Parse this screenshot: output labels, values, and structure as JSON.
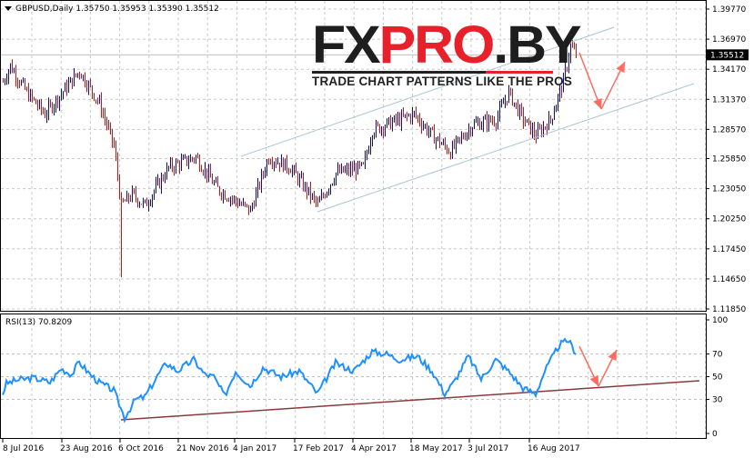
{
  "header": {
    "symbol": "GBPUSD,Daily",
    "open": "1.35750",
    "high": "1.35953",
    "low": "1.35390",
    "close": "1.35512",
    "dropdown_icon": "triangle-down-icon"
  },
  "logo": {
    "part1": "FX",
    "part2": "PRO",
    "part3": ".BY",
    "tagline": "TRADE CHART PATTERNS LIKE THE PROS"
  },
  "colors": {
    "up": "#0000ff",
    "down": "#ff0000",
    "rsi": "#1e90ff",
    "channel": "#a8c4d4",
    "arrow": "#ff6b5e",
    "rsi_trend": "#8b3a3a"
  },
  "chart_data": [
    {
      "type": "line",
      "title": "GBPUSD,Daily",
      "ylim": [
        1.1185,
        1.3977
      ],
      "y_ticks": [
        "1.39770",
        "1.36970",
        "1.34170",
        "1.31370",
        "1.28570",
        "1.25850",
        "1.23050",
        "1.20250",
        "1.17450",
        "1.14650",
        "1.11850"
      ],
      "current_price": "1.35512",
      "x_tick_labels": [
        "8 Jul 2016",
        "23 Aug 2016",
        "6 Oct 2016",
        "21 Nov 2016",
        "4 Jan 2017",
        "17 Feb 2017",
        "4 Apr 2017",
        "18 May 2017",
        "3 Jul 2017",
        "16 Aug 2017"
      ],
      "close_path": [
        [
          0,
          1.33
        ],
        [
          4,
          1.345
        ],
        [
          13,
          1.32
        ],
        [
          23,
          1.3
        ],
        [
          42,
          1.34
        ],
        [
          53,
          1.31
        ],
        [
          61,
          1.27
        ],
        [
          65,
          1.215
        ],
        [
          71,
          1.225
        ],
        [
          78,
          1.215
        ],
        [
          91,
          1.25
        ],
        [
          106,
          1.26
        ],
        [
          118,
          1.23
        ],
        [
          136,
          1.21
        ],
        [
          146,
          1.26
        ],
        [
          158,
          1.25
        ],
        [
          173,
          1.215
        ],
        [
          183,
          1.245
        ],
        [
          198,
          1.25
        ],
        [
          203,
          1.285
        ],
        [
          226,
          1.3
        ],
        [
          236,
          1.28
        ],
        [
          246,
          1.265
        ],
        [
          258,
          1.29
        ],
        [
          271,
          1.295
        ],
        [
          278,
          1.32
        ],
        [
          286,
          1.295
        ],
        [
          293,
          1.28
        ],
        [
          301,
          1.295
        ],
        [
          308,
          1.33
        ],
        [
          312,
          1.363
        ],
        [
          315,
          1.355
        ]
      ],
      "spike_low": [
        65,
        1.148
      ],
      "channel_upper": [
        [
          131,
          1.2606
        ],
        [
          336,
          1.3808
        ]
      ],
      "channel_lower": [
        [
          173,
          1.209
        ],
        [
          380,
          1.3283
        ]
      ],
      "forecast_arrows": [
        [
          317,
          1.3571
        ],
        [
          329,
          1.3046
        ],
        [
          342,
          1.3486
        ]
      ]
    },
    {
      "type": "line",
      "title": "RSI(13) 70.8209",
      "ylim": [
        0,
        100
      ],
      "y_ticks": [
        "100",
        "70",
        "50",
        "30",
        "0"
      ],
      "rsi_path": [
        [
          0,
          35
        ],
        [
          2,
          44
        ],
        [
          8,
          47
        ],
        [
          17,
          49
        ],
        [
          26,
          45
        ],
        [
          32,
          57
        ],
        [
          38,
          52
        ],
        [
          42,
          63
        ],
        [
          48,
          52
        ],
        [
          53,
          45
        ],
        [
          61,
          38
        ],
        [
          67,
          14
        ],
        [
          73,
          30
        ],
        [
          78,
          32
        ],
        [
          86,
          53
        ],
        [
          90,
          62
        ],
        [
          96,
          55
        ],
        [
          105,
          65
        ],
        [
          111,
          52
        ],
        [
          116,
          50
        ],
        [
          122,
          33
        ],
        [
          128,
          55
        ],
        [
          136,
          42
        ],
        [
          143,
          58
        ],
        [
          153,
          50
        ],
        [
          163,
          55
        ],
        [
          173,
          35
        ],
        [
          183,
          62
        ],
        [
          193,
          55
        ],
        [
          203,
          72
        ],
        [
          211,
          70
        ],
        [
          218,
          65
        ],
        [
          228,
          68
        ],
        [
          236,
          55
        ],
        [
          243,
          35
        ],
        [
          248,
          45
        ],
        [
          256,
          68
        ],
        [
          263,
          48
        ],
        [
          271,
          65
        ],
        [
          278,
          55
        ],
        [
          286,
          40
        ],
        [
          293,
          35
        ],
        [
          298,
          55
        ],
        [
          306,
          78
        ],
        [
          311,
          82
        ],
        [
          315,
          71
        ]
      ],
      "trendline": [
        [
          65,
          12
        ],
        [
          383,
          46.4
        ]
      ]
    }
  ]
}
